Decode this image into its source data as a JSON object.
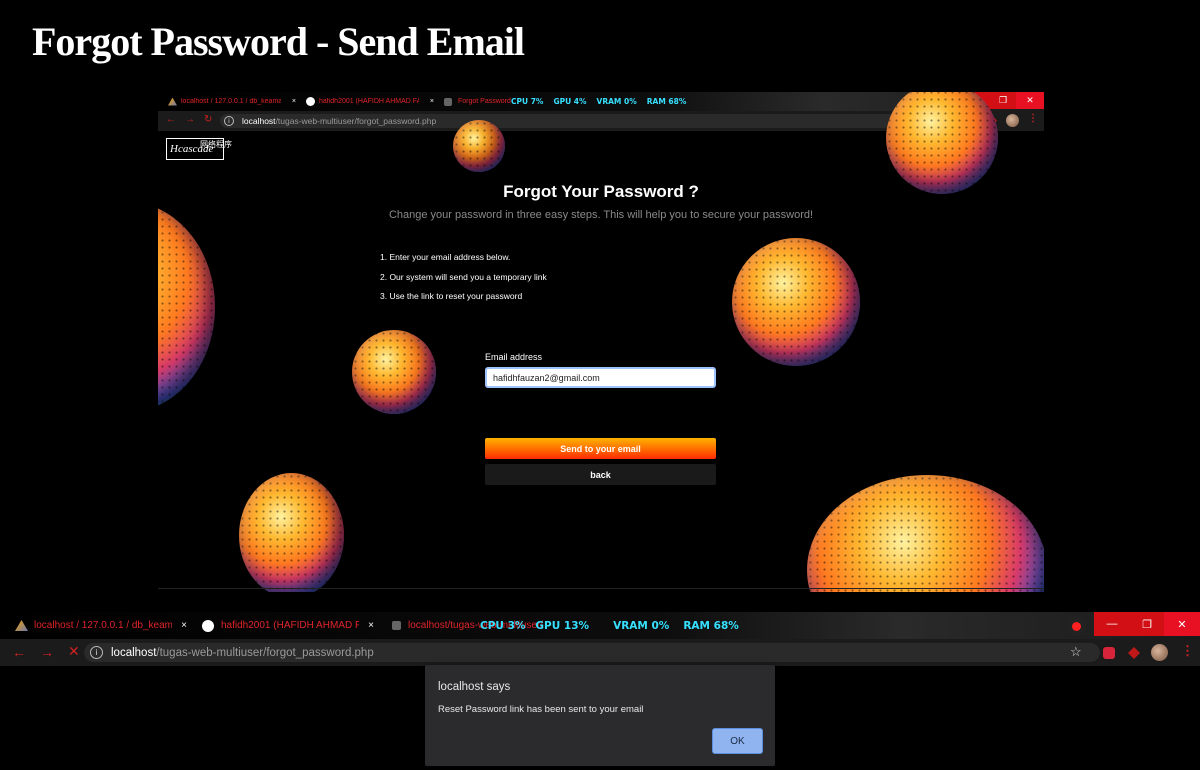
{
  "heading": "Forgot Password - Send Email",
  "browser_top": {
    "tabs": [
      {
        "title": "localhost / 127.0.0.1 / db_keamar",
        "close": "×"
      },
      {
        "title": "hafidh2001 (HAFIDH AHMAD FA",
        "close": "×"
      },
      {
        "title": "Forgot Password"
      }
    ],
    "stats": {
      "cpu": "CPU 7%",
      "gpu": "GPU 4%",
      "vram": "VRAM 0%",
      "ram": "RAM 68%"
    },
    "window": {
      "min": "—",
      "max": "❐",
      "close": "✕"
    },
    "url_host": "localhost",
    "url_path": "/tugas-web-multiuser/forgot_password.php"
  },
  "page": {
    "logo_text": "Hcascade",
    "logo_cn": "网络程序",
    "title": "Forgot Your Password ?",
    "subtitle": "Change your password in three easy steps. This will help you to secure your password!",
    "steps": [
      "1. Enter your email address below.",
      "2. Our system will send you a temporary link",
      "3. Use the link to reset your password"
    ],
    "email_label": "Email address",
    "email_value": "hafidhfauzan2@gmail.com",
    "send_button": "Send to your email",
    "back_button": "back"
  },
  "browser_bottom": {
    "tabs": [
      {
        "title": "localhost / 127.0.0.1 / db_keamar",
        "close": "×"
      },
      {
        "title": "hafidh2001 (HAFIDH AHMAD FA",
        "close": "×"
      },
      {
        "title": "localhost/tugas-web-multiuser/"
      }
    ],
    "stats": {
      "cpu": "CPU 3%",
      "gpu": "GPU 13%",
      "vram": "VRAM 0%",
      "ram": "RAM 68%"
    },
    "window": {
      "min": "—",
      "max": "❐",
      "close": "✕"
    },
    "url_host": "localhost",
    "url_path": "/tugas-web-multiuser/forgot_password.php"
  },
  "dialog": {
    "title": "localhost says",
    "message": "Reset Password link has been sent to your email",
    "ok": "OK"
  },
  "colors": {
    "accent": "#e0242a",
    "stats": "#36e0ff",
    "ok_button": "#8fb4f0"
  },
  "icons": [
    "back-arrow-icon",
    "forward-arrow-icon",
    "reload-icon",
    "stop-icon",
    "info-icon",
    "star-icon",
    "github-icon",
    "phpmyadmin-icon",
    "record-icon",
    "extension-icon",
    "avatar",
    "menu-kebab-icon"
  ]
}
